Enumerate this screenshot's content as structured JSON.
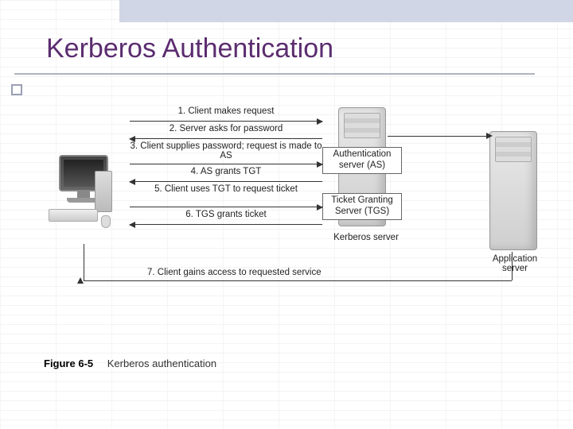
{
  "slide": {
    "title": "Kerberos Authentication"
  },
  "steps": {
    "s1": "1. Client makes request",
    "s2": "2. Server asks for password",
    "s3": "3. Client supplies password; request is made to AS",
    "s4": "4. AS grants TGT",
    "s5": "5. Client uses TGT to request ticket",
    "s6": "6. TGS grants ticket",
    "s7": "7. Client gains access to requested service"
  },
  "labels": {
    "as": "Authentication server (AS)",
    "tgs": "Ticket Granting Server (TGS)",
    "kerberos": "Kerberos server",
    "app": "Application server"
  },
  "caption": {
    "figno": "Figure 6-5",
    "text": "Kerberos authentication"
  }
}
